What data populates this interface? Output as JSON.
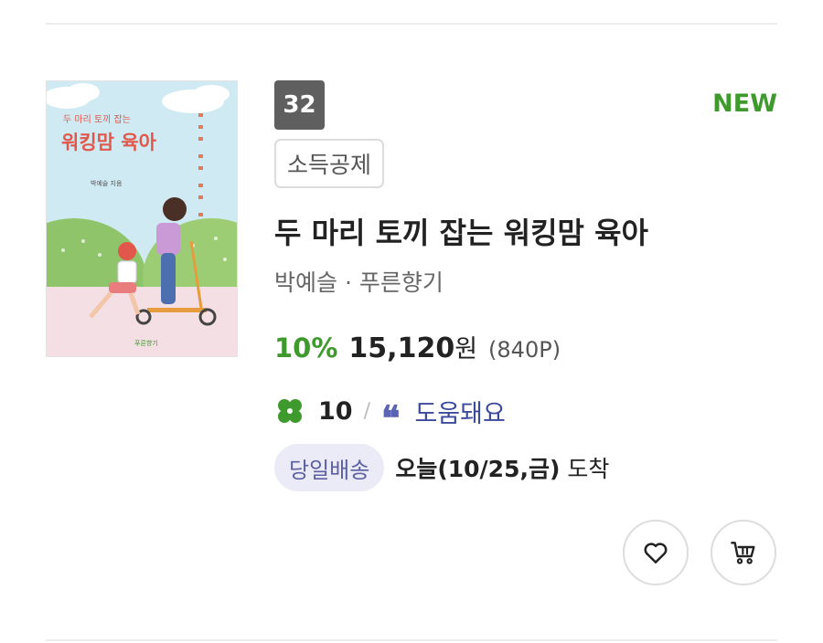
{
  "product": {
    "rank": "32",
    "badge": "NEW",
    "tag": "소득공제",
    "title": "두 마리 토끼 잡는 워킹맘 육아",
    "author_publisher": "박예슬 · 푸른향기",
    "discount": "10%",
    "price": "15,120",
    "currency": "원",
    "points": "(840P)",
    "review_count": "10",
    "review_separator": "/",
    "helpful_label": "도움돼요",
    "delivery_badge": "당일배송",
    "arrival_date": "오늘(10/25,금)",
    "arrival_suffix": "도착",
    "cover": {
      "small_title": "두 마리 토끼 잡는",
      "big_title": "워킹맘 육아",
      "author_small": "박예슬 지음",
      "publisher_small": "푸른향기"
    }
  },
  "icons": {
    "clover": "clover-icon",
    "quote": "quote-icon",
    "wishlist": "heart-icon",
    "cart": "cart-icon"
  },
  "colors": {
    "accent_green": "#3f9a2d",
    "review_blue": "#3c4a9c",
    "rank_bg": "#5f5f5f",
    "delivery_badge_bg": "#ebeaf7"
  }
}
